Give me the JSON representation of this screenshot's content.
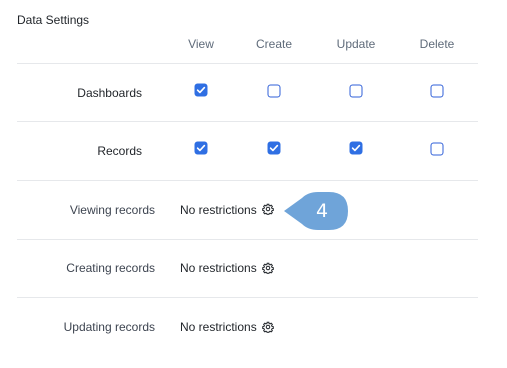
{
  "section": {
    "title": "Data Settings"
  },
  "columns": [
    "View",
    "Create",
    "Update",
    "Delete"
  ],
  "permission_rows": [
    {
      "label": "Dashboards",
      "view": true,
      "create": false,
      "update": false,
      "delete": false
    },
    {
      "label": "Records",
      "view": true,
      "create": true,
      "update": true,
      "delete": false
    }
  ],
  "restriction_rows": [
    {
      "label": "Viewing records",
      "value": "No restrictions"
    },
    {
      "label": "Creating records",
      "value": "No restrictions"
    },
    {
      "label": "Updating records",
      "value": "No restrictions"
    }
  ],
  "callout": {
    "number": "4"
  },
  "icons": {
    "settings": "gear-icon",
    "checked": "checkmark-icon"
  },
  "colors": {
    "accent": "#2f6fe3",
    "callout": "#6fa4d9",
    "divider": "#e6e8eb"
  }
}
